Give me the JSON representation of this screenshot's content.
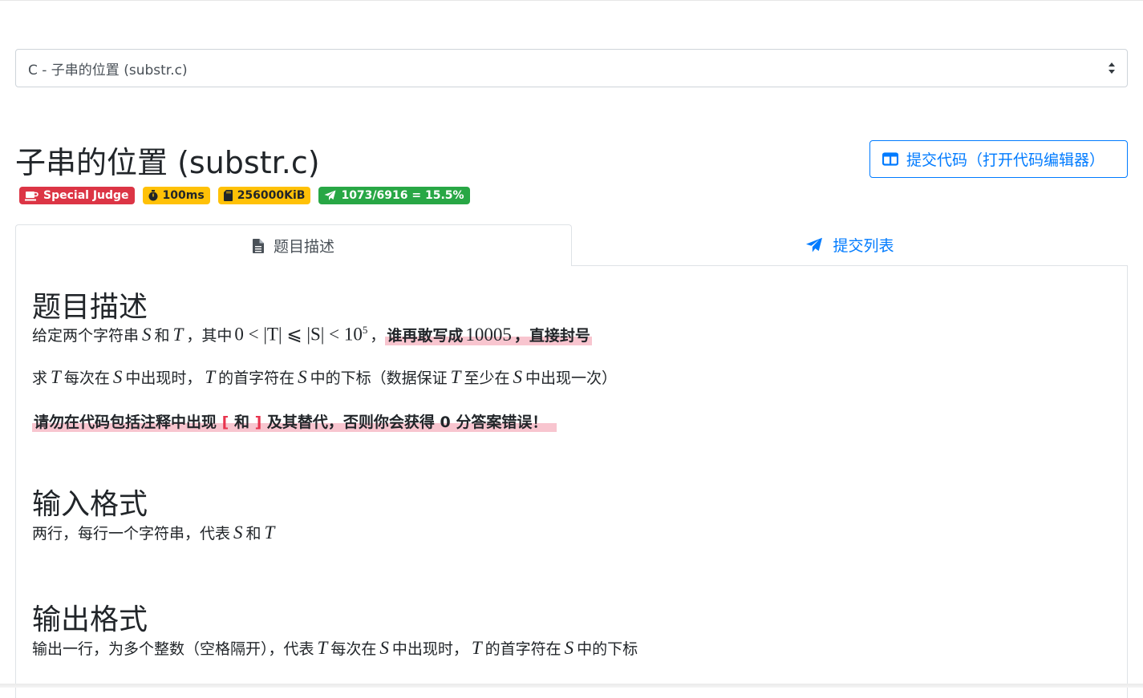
{
  "problem_select": {
    "value": "C - 子串的位置 (substr.c)"
  },
  "header": {
    "title": "子串的位置 (substr.c)",
    "submit_button": "提交代码（打开代码编辑器）"
  },
  "badges": {
    "judge": "Special Judge",
    "time": "100ms",
    "memory": "256000KiB",
    "stats": "1073/6916 = 15.5%"
  },
  "tabs": {
    "description": "题目描述",
    "submissions": "提交列表"
  },
  "content": {
    "desc_title": "题目描述",
    "desc_p1": {
      "t1": "给定两个字符串",
      "s": "S",
      "t2": "和",
      "t": "T",
      "t3": "，其中",
      "formula": "0 < |T| ⩽ |S| < 10",
      "exp": "5",
      "t4": "，",
      "warn1": "谁再敢写成",
      "warn_num": "10005",
      "warn2": "，直接封号"
    },
    "desc_p2": {
      "t1": "求",
      "t": "T",
      "t2": "每次在",
      "s": "S",
      "t3": "中出现时，",
      "t4": "的首字符在",
      "t5": "中的下标（数据保证",
      "t6": "至少在",
      "t7": "中出现一次）"
    },
    "desc_p3": {
      "a": "请勿在代码包括注释中出现",
      "b1": "[",
      "b2": "和",
      "b3": "]",
      "c": "及其替代，否则你会获得 0 分答案错误！"
    },
    "input_title": "输入格式",
    "input_p": {
      "t1": "两行，每行一个字符串，代表",
      "s": "S",
      "t2": "和",
      "t": "T"
    },
    "output_title": "输出格式",
    "output_p": {
      "t1": "输出一行，为多个整数（空格隔开），代表",
      "t": "T",
      "t2": "每次在",
      "s": "S",
      "t3": "中出现时，",
      "t4": "的首字符在",
      "t5": "中的下标"
    }
  },
  "colors": {
    "primary": "#007bff",
    "danger": "#dc3545",
    "warning": "#ffc107",
    "success": "#28a745",
    "highlight": "#f8c5cf"
  },
  "icons": [
    "select-arrows-icon",
    "book-open-icon",
    "coffee-icon",
    "stopwatch-icon",
    "sd-card-icon",
    "paper-plane-icon",
    "file-icon"
  ]
}
